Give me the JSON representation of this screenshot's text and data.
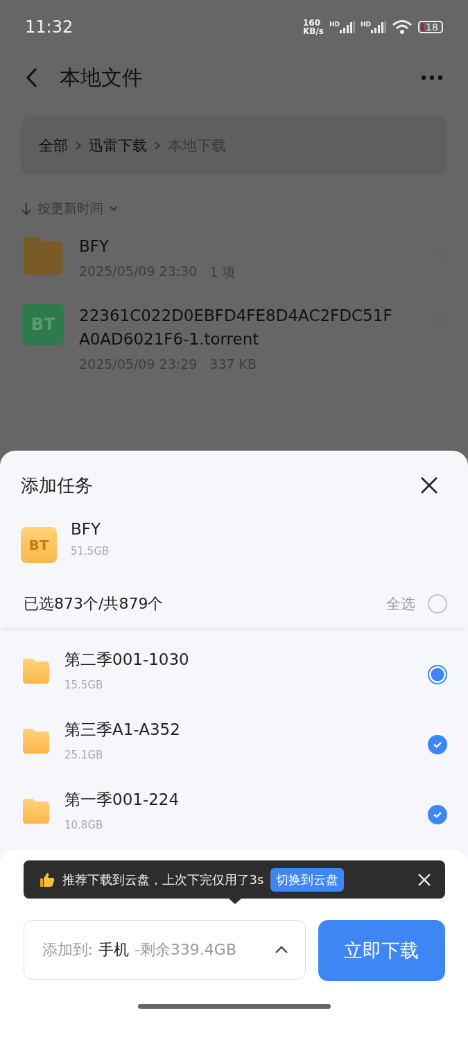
{
  "status_bar": {
    "time": "11:32",
    "speed_value": "160",
    "speed_unit": "KB/s",
    "signal_labels": [
      "HD",
      "HD"
    ],
    "battery": "18"
  },
  "header": {
    "title": "本地文件"
  },
  "breadcrumb": [
    {
      "label": "全部",
      "current": false
    },
    {
      "label": "迅雷下载",
      "current": false
    },
    {
      "label": "本地下载",
      "current": true
    }
  ],
  "sort": {
    "label": "按更新时间"
  },
  "files": [
    {
      "kind": "folder",
      "name": "BFY",
      "date": "2025/05/09 23:30",
      "info": "1 项",
      "selected": false
    },
    {
      "kind": "torrent",
      "icon_text": "BT",
      "name": "22361C022D0EBFD4FE8D4AC2FDC51FA0AD6021F6-1.torrent",
      "date": "2025/05/09 23:29",
      "info": "337 KB",
      "selected": false
    }
  ],
  "sheet": {
    "title": "添加任务",
    "task": {
      "icon_text": "BT",
      "name": "BFY",
      "size": "51.5GB"
    },
    "selection_summary": "已选873个/共879个",
    "select_all": {
      "label": "全选",
      "checked": false
    },
    "items": [
      {
        "name": "第二季001-1030",
        "size": "15.5GB",
        "checked": false,
        "partial": true
      },
      {
        "name": "第三季A1-A352",
        "size": "25.1GB",
        "checked": true
      },
      {
        "name": "第一季001-224",
        "size": "10.8GB",
        "checked": true
      }
    ],
    "tip": {
      "text": "推荐下载到云盘，上次下完仅用了3s",
      "action": "切换到云盘"
    },
    "destination": {
      "prefix": "添加到:",
      "device": "手机",
      "remaining": "-剩余339.4GB"
    },
    "download_button": "立即下载"
  }
}
